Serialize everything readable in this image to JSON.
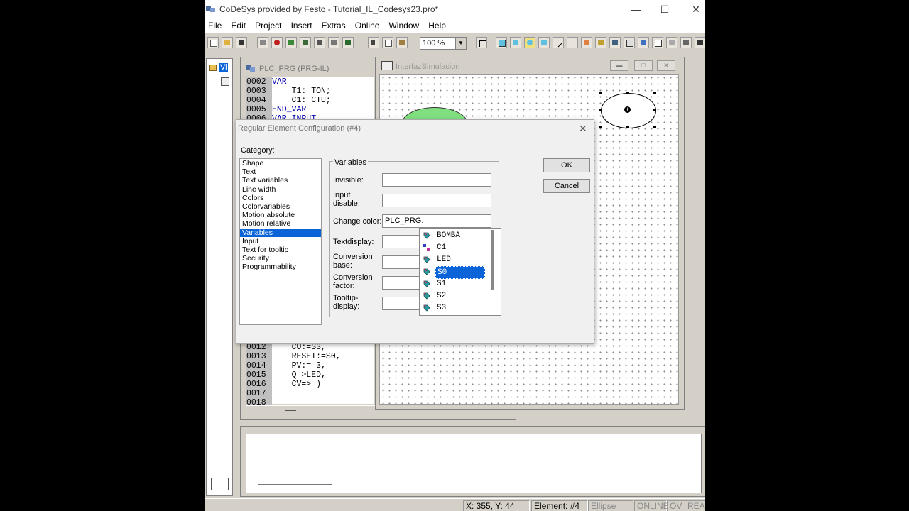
{
  "window": {
    "title": "CoDeSys provided by Festo - Tutorial_IL_Codesys23.pro*"
  },
  "menu": [
    "File",
    "Edit",
    "Project",
    "Insert",
    "Extras",
    "Online",
    "Window",
    "Help"
  ],
  "toolbar": {
    "zoom_value": "100 %"
  },
  "left_panel": {
    "tab_label": "Vi"
  },
  "editor": {
    "title": "PLC_PRG (PRG-IL)",
    "top_lines": [
      {
        "num": "0002",
        "code": "VAR",
        "kw": true
      },
      {
        "num": "0003",
        "code": "    T1: TON;",
        "kw": false
      },
      {
        "num": "0004",
        "code": "    C1: CTU;",
        "kw": false
      },
      {
        "num": "0005",
        "code": "END_VAR",
        "kw": true
      },
      {
        "num": "0006",
        "code": "VAR_INPUT",
        "kw": true
      }
    ],
    "bottom_lines": [
      {
        "num": "0012",
        "code": "    CU:=S3,"
      },
      {
        "num": "0013",
        "code": "    RESET:=S0,"
      },
      {
        "num": "0014",
        "code": "    PV:= 3,"
      },
      {
        "num": "0015",
        "code": "    Q=>LED,"
      },
      {
        "num": "0016",
        "code": "    CV=> )"
      },
      {
        "num": "0017",
        "code": ""
      },
      {
        "num": "0018",
        "code": ""
      }
    ]
  },
  "interface_window": {
    "title": "InterfazSimulacion"
  },
  "dialog": {
    "title": "Regular Element Configuration (#4)",
    "category_label": "Category:",
    "categories": [
      "Shape",
      "Text",
      "Text variables",
      "Line width",
      "Colors",
      "Colorvariables",
      "Motion absolute",
      "Motion relative",
      "Variables",
      "Input",
      "Text for tooltip",
      "Security",
      "Programmability"
    ],
    "selected_category": "Variables",
    "group_label": "Variables",
    "fields": {
      "invisible": {
        "label": "Invisible:",
        "value": ""
      },
      "input_disable": {
        "label1": "Input",
        "label2": "disable:",
        "value": ""
      },
      "change_color": {
        "label": "Change color:",
        "value": "PLC_PRG."
      },
      "textdisplay": {
        "label": "Textdisplay:",
        "value": ""
      },
      "conversion_base": {
        "label1": "Conversion",
        "label2": "base:",
        "value": ""
      },
      "conversion_factor": {
        "label1": "Conversion",
        "label2": "factor:",
        "value": ""
      },
      "tooltip_display": {
        "label1": "Tooltip-",
        "label2": "display:",
        "value": ""
      }
    },
    "ok_label": "OK",
    "cancel_label": "Cancel",
    "variable_list": [
      {
        "name": "BOMBA",
        "icon": "variable-icon"
      },
      {
        "name": "C1",
        "icon": "function-block-icon"
      },
      {
        "name": "LED",
        "icon": "variable-icon"
      },
      {
        "name": "S0",
        "icon": "variable-icon",
        "selected": true
      },
      {
        "name": "S1",
        "icon": "variable-icon"
      },
      {
        "name": "S2",
        "icon": "variable-icon"
      },
      {
        "name": "S3",
        "icon": "variable-icon"
      }
    ]
  },
  "status_bar": {
    "coords": "X:   355, Y:    44",
    "element": "Element: #4",
    "shape": "Ellipse",
    "online": "ONLINE",
    "ov": "OV",
    "read": "READ"
  }
}
